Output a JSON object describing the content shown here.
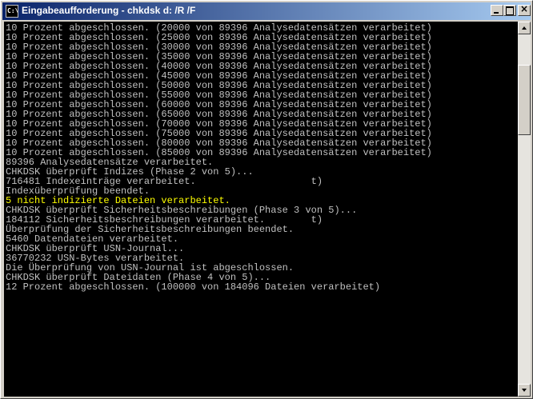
{
  "window": {
    "title": "Eingabeaufforderung - chkdsk d: /R /F",
    "icon_name": "cmd-icon",
    "icon_text": "C:\\",
    "close_glyph": "×"
  },
  "console": {
    "lines": [
      "10 Prozent abgeschlossen. (20000 von 89396 Analysedatensätzen verarbeitet)",
      "10 Prozent abgeschlossen. (25000 von 89396 Analysedatensätzen verarbeitet)",
      "10 Prozent abgeschlossen. (30000 von 89396 Analysedatensätzen verarbeitet)",
      "10 Prozent abgeschlossen. (35000 von 89396 Analysedatensätzen verarbeitet)",
      "10 Prozent abgeschlossen. (40000 von 89396 Analysedatensätzen verarbeitet)",
      "10 Prozent abgeschlossen. (45000 von 89396 Analysedatensätzen verarbeitet)",
      "10 Prozent abgeschlossen. (50000 von 89396 Analysedatensätzen verarbeitet)",
      "10 Prozent abgeschlossen. (55000 von 89396 Analysedatensätzen verarbeitet)",
      "10 Prozent abgeschlossen. (60000 von 89396 Analysedatensätzen verarbeitet)",
      "10 Prozent abgeschlossen. (65000 von 89396 Analysedatensätzen verarbeitet)",
      "10 Prozent abgeschlossen. (70000 von 89396 Analysedatensätzen verarbeitet)",
      "10 Prozent abgeschlossen. (75000 von 89396 Analysedatensätzen verarbeitet)",
      "10 Prozent abgeschlossen. (80000 von 89396 Analysedatensätzen verarbeitet)",
      "10 Prozent abgeschlossen. (85000 von 89396 Analysedatensätzen verarbeitet)",
      "89396 Analysedatensätze verarbeitet.",
      "CHKDSK überprüft Indizes (Phase 2 von 5)...",
      "716481 Indexeinträge verarbeitet.                    t)",
      "Indexüberprüfung beendet.",
      "5 nicht indizierte Dateien verarbeitet.",
      "CHKDSK überprüft Sicherheitsbeschreibungen (Phase 3 von 5)...",
      "184112 Sicherheitsbeschreibungen verarbeitet.        t)",
      "Überprüfung der Sicherheitsbeschreibungen beendet.",
      "5460 Datendateien verarbeitet.",
      "CHKDSK überprüft USN-Journal...",
      "36770232 USN-Bytes verarbeitet.",
      "Die Überprüfung von USN-Journal ist abgeschlossen.",
      "CHKDSK überprüft Dateidaten (Phase 4 von 5)...",
      "12 Prozent abgeschlossen. (100000 von 184096 Dateien verarbeitet)"
    ],
    "highlight_line_index": 18,
    "text_color": "#c0c0c0",
    "highlight_color": "#ffff00",
    "background": "#000000"
  },
  "scrollbar": {
    "up_icon": "arrow-up-icon",
    "down_icon": "arrow-down-icon",
    "position_fraction": 0.13
  }
}
